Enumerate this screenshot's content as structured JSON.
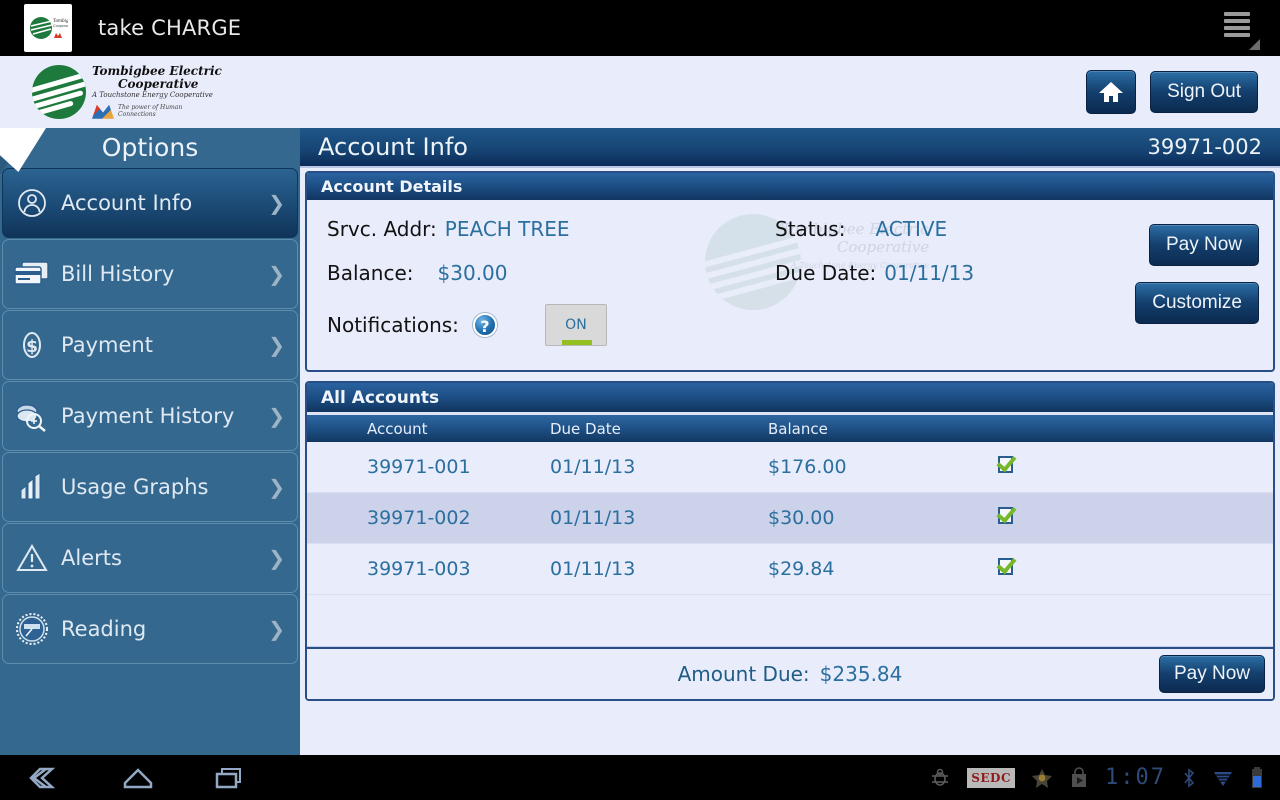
{
  "android": {
    "app_title": "take CHARGE",
    "app_icon": "tombigbee-logo-icon",
    "menu_icon": "hamburger-menu-icon"
  },
  "brand": {
    "line1": "Tombigbee Electric",
    "line1b": "Cooperative",
    "line2": "A Touchstone Energy Cooperative",
    "line3a": "The power of Human",
    "line3b": "Connections"
  },
  "header": {
    "home_icon": "home-icon",
    "sign_out_label": "Sign Out"
  },
  "sidebar": {
    "title": "Options",
    "items": [
      {
        "label": "Account Info",
        "icon": "user-circle-icon",
        "active": true
      },
      {
        "label": "Bill History",
        "icon": "credit-cards-icon",
        "active": false
      },
      {
        "label": "Payment",
        "icon": "dollar-coin-icon",
        "active": false
      },
      {
        "label": "Payment History",
        "icon": "money-search-icon",
        "active": false
      },
      {
        "label": "Usage Graphs",
        "icon": "bar-chart-icon",
        "active": false
      },
      {
        "label": "Alerts",
        "icon": "warning-triangle-icon",
        "active": false
      },
      {
        "label": "Reading",
        "icon": "meter-gauge-icon",
        "active": false
      }
    ],
    "chevron": "❯"
  },
  "page": {
    "title": "Account Info",
    "account_number": "39971-002"
  },
  "account_details": {
    "panel_title": "Account Details",
    "srvc_addr_label": "Srvc. Addr:",
    "srvc_addr_value": "PEACH TREE",
    "balance_label": "Balance:",
    "balance_value": "$30.00",
    "notifications_label": "Notifications:",
    "help_icon": "question-help-icon",
    "notifications_state": "ON",
    "status_label": "Status:",
    "status_value": "ACTIVE",
    "due_date_label": "Due Date:",
    "due_date_value": "01/11/13",
    "pay_now_label": "Pay Now",
    "customize_label": "Customize"
  },
  "watermark": {
    "line1": "Tombigbee Electric",
    "line2": "Cooperative",
    "line3": "A Touchstone Energy Cooperative"
  },
  "all_accounts": {
    "panel_title": "All Accounts",
    "columns": [
      "Account",
      "Due Date",
      "Balance",
      ""
    ],
    "rows": [
      {
        "account": "39971-001",
        "due_date": "01/11/13",
        "balance": "$176.00",
        "checked": true,
        "selected": false
      },
      {
        "account": "39971-002",
        "due_date": "01/11/13",
        "balance": "$30.00",
        "checked": true,
        "selected": true
      },
      {
        "account": "39971-003",
        "due_date": "01/11/13",
        "balance": "$29.84",
        "checked": true,
        "selected": false
      }
    ],
    "amount_due_label": "Amount Due:",
    "amount_due_value": "$235.84",
    "pay_now_label": "Pay Now"
  },
  "navbar": {
    "back_icon": "back-arrow-icon",
    "home_icon": "home-outline-icon",
    "recents_icon": "recent-apps-icon",
    "status_icons": [
      "debug-bug-icon",
      "sedc-app-icon",
      "star-icon",
      "play-store-icon"
    ],
    "sedc_label": "SEDC",
    "clock": "1:07",
    "bluetooth_icon": "bluetooth-icon",
    "wifi_icon": "wifi-icon",
    "battery_icon": "battery-icon"
  },
  "colors": {
    "accent_blue": "#2b6f9e",
    "header_navy": "#11355f",
    "sidebar_blue": "#35688f",
    "brand_green": "#1e7a3c",
    "check_green": "#77b82a",
    "page_bg": "#e9ecfb"
  }
}
